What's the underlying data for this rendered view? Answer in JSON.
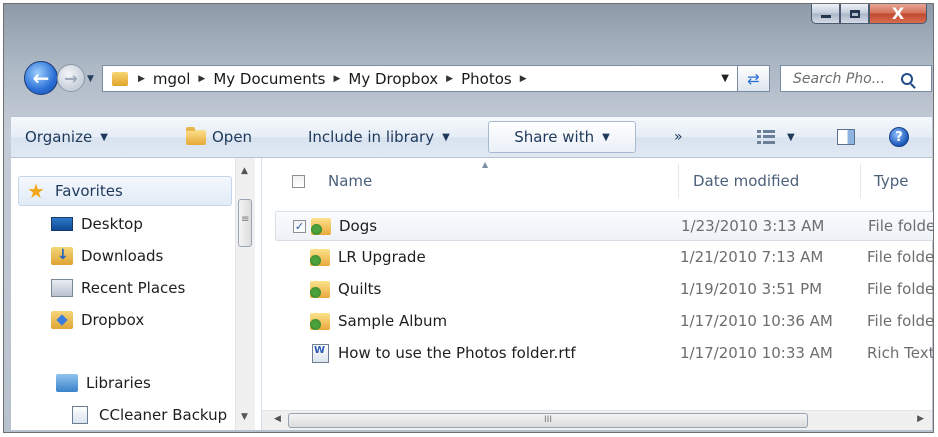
{
  "window": {
    "minimize_glyph": "minimize",
    "maximize_glyph": "maximize",
    "close_label": "X"
  },
  "navigation": {
    "back_icon": "back-arrow-icon",
    "forward_icon": "forward-arrow-icon",
    "breadcrumb": [
      "mgol",
      "My Documents",
      "My Dropbox",
      "Photos"
    ],
    "search_placeholder": "Search Pho..."
  },
  "toolbar": {
    "organize": "Organize",
    "open": "Open",
    "include_in_library": "Include in library",
    "share_with": "Share with",
    "more": "»"
  },
  "nav_pane": {
    "favorites": "Favorites",
    "favorites_items": [
      "Desktop",
      "Downloads",
      "Recent Places",
      "Dropbox"
    ],
    "libraries": "Libraries",
    "libraries_items": [
      "CCleaner Backup"
    ]
  },
  "file_list": {
    "columns": {
      "name": "Name",
      "date_modified": "Date modified",
      "type": "Type"
    },
    "files": [
      {
        "name": "Dogs",
        "date": "1/23/2010 3:13 AM",
        "type": "File folder",
        "checked": true,
        "kind": "folder"
      },
      {
        "name": "LR Upgrade",
        "date": "1/21/2010 7:13 AM",
        "type": "File folder",
        "kind": "folder"
      },
      {
        "name": "Quilts",
        "date": "1/19/2010 3:51 PM",
        "type": "File folder",
        "kind": "folder"
      },
      {
        "name": "Sample Album",
        "date": "1/17/2010 10:36 AM",
        "type": "File folder",
        "kind": "folder"
      },
      {
        "name": "How to use the Photos folder.rtf",
        "date": "1/17/2010 10:33 AM",
        "type": "Rich Text",
        "kind": "rtf"
      }
    ]
  },
  "scrollbar_grip": "III"
}
